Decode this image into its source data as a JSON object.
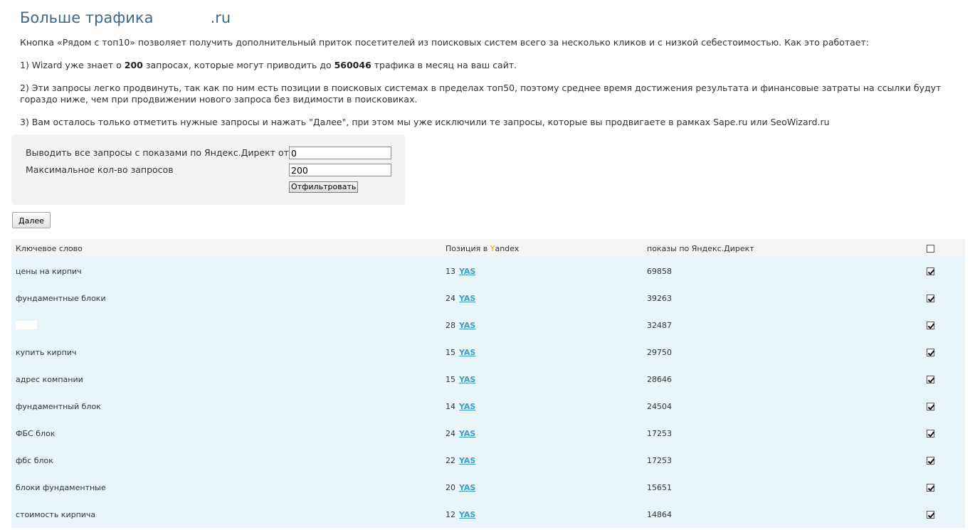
{
  "header": {
    "title": "Больше трафика",
    "domain_suffix": ".ru"
  },
  "description": {
    "intro": "Кнопка «Рядом с топ10» позволяет получить дополнительный приток посетителей из поисковых систем всего за несколько кликов и с низкой себестоимостью. Как это работает:",
    "step1_prefix": "1) Wizard уже знает о ",
    "step1_count": "200",
    "step1_middle": " запросах, которые могут приводить до ",
    "step1_traffic": "560046",
    "step1_suffix": " трафика в месяц на ваш сайт.",
    "step2": "2) Эти запросы легко продвинуть, так как по ним есть позиции в поисковых системах в пределах топ50, поэтому среднее время достижения результата и финансовые затраты на ссылки будут гораздо ниже, чем при продвижении нового запроса без видимости в поисковиках.",
    "step3": "3) Вам осталось только отметить нужные запросы и нажать \"Далее\", при этом мы уже исключили те запросы, которые вы продвигаете в рамках Sape.ru или SeoWizard.ru"
  },
  "filter": {
    "min_impressions_label": "Выводить все запросы с показами по Яндекс.Директ от",
    "min_impressions_value": "0",
    "max_queries_label": "Максимальное кол-во запросов",
    "max_queries_value": "200",
    "submit_label": "Отфильтровать"
  },
  "next_button": "Далее",
  "table": {
    "headers": {
      "keyword": "Ключевое слово",
      "position_prefix": "Позиция в ",
      "position_y": "Y",
      "position_rest": "andex",
      "impressions": "показы по Яндекс.Директ",
      "select_all_checked": false
    },
    "link_label": "YAS",
    "rows": [
      {
        "keyword": "цены на кирпич",
        "position": "13",
        "impressions": "69858",
        "checked": true
      },
      {
        "keyword": "фундаментные блоки",
        "position": "24",
        "impressions": "39263",
        "checked": true
      },
      {
        "keyword": "",
        "position": "28",
        "impressions": "32487",
        "checked": true
      },
      {
        "keyword": "купить кирпич",
        "position": "15",
        "impressions": "29750",
        "checked": true
      },
      {
        "keyword": "адрес компании",
        "position": "15",
        "impressions": "28646",
        "checked": true
      },
      {
        "keyword": "фундаментный блок",
        "position": "14",
        "impressions": "24504",
        "checked": true
      },
      {
        "keyword": "ФБС блок",
        "position": "24",
        "impressions": "17253",
        "checked": true
      },
      {
        "keyword": "фбс блок",
        "position": "22",
        "impressions": "17253",
        "checked": true
      },
      {
        "keyword": "блоки фундаментные",
        "position": "20",
        "impressions": "15651",
        "checked": true
      },
      {
        "keyword": "стоимость кирпича",
        "position": "12",
        "impressions": "14864",
        "checked": true
      }
    ]
  },
  "colors": {
    "title": "#3d6a8a",
    "row_background": "#eaf5fa",
    "link": "#3a9ec7",
    "yandex_y": "#e8a000"
  }
}
